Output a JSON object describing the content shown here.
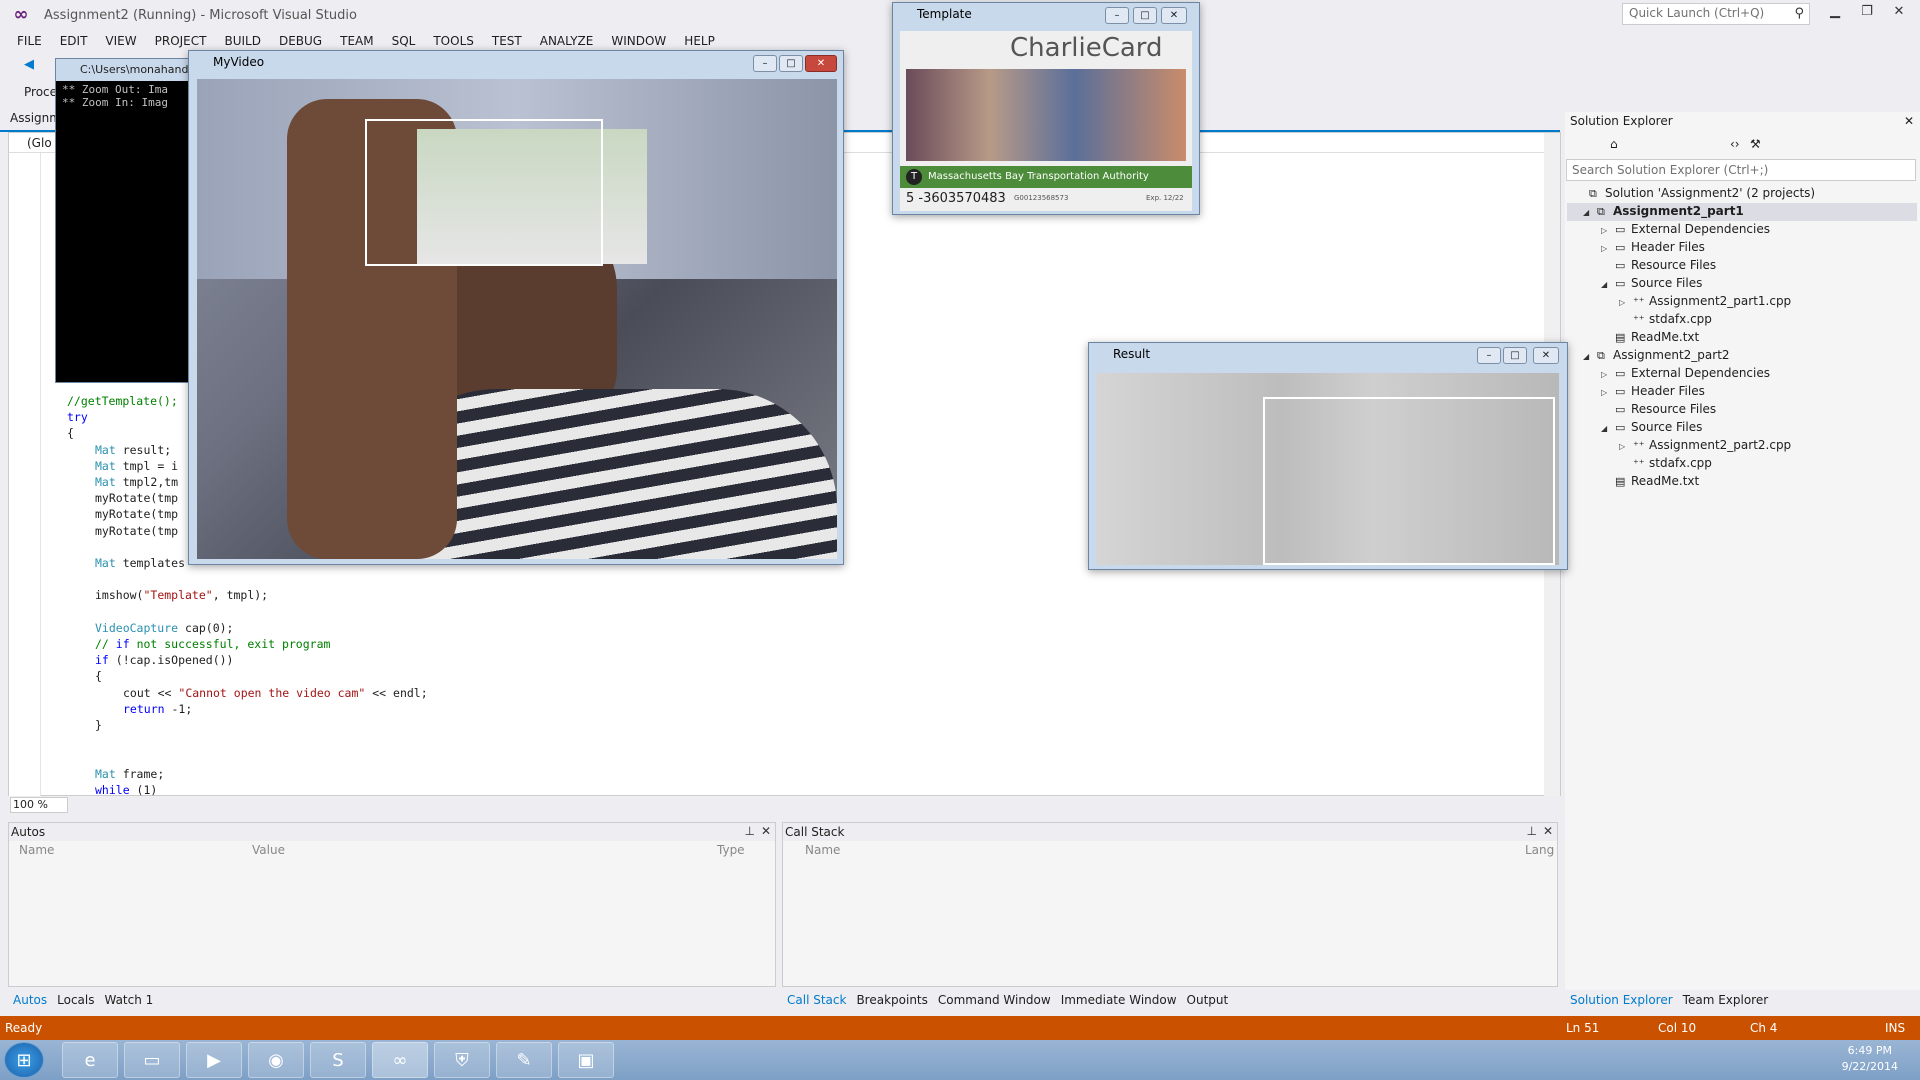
{
  "window": {
    "title": "Assignment2 (Running) - Microsoft Visual Studio",
    "quick_launch": "Quick Launch (Ctrl+Q)"
  },
  "menu": [
    "FILE",
    "EDIT",
    "VIEW",
    "PROJECT",
    "BUILD",
    "DEBUG",
    "TEAM",
    "SQL",
    "TOOLS",
    "TEST",
    "ANALYZE",
    "WINDOW",
    "HELP"
  ],
  "toolbar": {
    "process_label": "Proce",
    "doc_tab": "Assignm",
    "scope": "(Glo"
  },
  "code_lines": [
    {
      "cls": "cm",
      "indent": 1,
      "text": "//getTemplate();"
    },
    {
      "cls": "kw",
      "indent": 1,
      "text": "try"
    },
    {
      "cls": "",
      "indent": 1,
      "text": "{"
    },
    {
      "cls": "",
      "indent": 2,
      "text": "Mat result;"
    },
    {
      "cls": "",
      "indent": 2,
      "text": "Mat tmpl = i"
    },
    {
      "cls": "",
      "indent": 2,
      "text": "Mat tmpl2,tm"
    },
    {
      "cls": "",
      "indent": 2,
      "text": "myRotate(tmp"
    },
    {
      "cls": "",
      "indent": 2,
      "text": "myRotate(tmp"
    },
    {
      "cls": "",
      "indent": 2,
      "text": "myRotate(tmp"
    },
    {
      "cls": "",
      "indent": 0,
      "text": ""
    },
    {
      "cls": "",
      "indent": 2,
      "text": "Mat templates"
    },
    {
      "cls": "",
      "indent": 0,
      "text": ""
    },
    {
      "cls": "",
      "indent": 2,
      "text": "imshow(\"Template\", tmpl);"
    },
    {
      "cls": "",
      "indent": 0,
      "text": ""
    },
    {
      "cls": "",
      "indent": 2,
      "text": "VideoCapture cap(0);"
    },
    {
      "cls": "cm",
      "indent": 2,
      "text": "// if not successful, exit program"
    },
    {
      "cls": "",
      "indent": 2,
      "text": "if (!cap.isOpened())"
    },
    {
      "cls": "",
      "indent": 2,
      "text": "{"
    },
    {
      "cls": "",
      "indent": 3,
      "text": "cout << \"Cannot open the video cam\" << endl;"
    },
    {
      "cls": "",
      "indent": 3,
      "text": "return -1;"
    },
    {
      "cls": "",
      "indent": 2,
      "text": "}"
    },
    {
      "cls": "",
      "indent": 0,
      "text": ""
    },
    {
      "cls": "",
      "indent": 0,
      "text": ""
    },
    {
      "cls": "",
      "indent": 2,
      "text": "Mat frame;"
    },
    {
      "cls": "",
      "indent": 2,
      "text": "while (1)"
    }
  ],
  "editor": {
    "zoom": "100 %"
  },
  "autos": {
    "title": "Autos",
    "cols": [
      "Name",
      "Value",
      "Type"
    ]
  },
  "callstack": {
    "title": "Call Stack",
    "cols": [
      "Name",
      "Lang"
    ]
  },
  "bottom_tabs_left": [
    "Autos",
    "Locals",
    "Watch 1"
  ],
  "bottom_tabs_right": [
    "Call Stack",
    "Breakpoints",
    "Command Window",
    "Immediate Window",
    "Output"
  ],
  "solution_explorer": {
    "title": "Solution Explorer",
    "search": "Search Solution Explorer (Ctrl+;)",
    "nodes": [
      {
        "label": "Solution 'Assignment2' (2 projects)",
        "level": 0,
        "arrow": "",
        "bold": false
      },
      {
        "label": "Assignment2_part1",
        "level": 0,
        "arrow": "◢",
        "bold": true
      },
      {
        "label": "External Dependencies",
        "level": 1,
        "arrow": "▷",
        "bold": false
      },
      {
        "label": "Header Files",
        "level": 1,
        "arrow": "▷",
        "bold": false
      },
      {
        "label": "Resource Files",
        "level": 1,
        "arrow": "",
        "bold": false
      },
      {
        "label": "Source Files",
        "level": 1,
        "arrow": "◢",
        "bold": false
      },
      {
        "label": "Assignment2_part1.cpp",
        "level": 2,
        "arrow": "▷",
        "bold": false
      },
      {
        "label": "stdafx.cpp",
        "level": 2,
        "arrow": "",
        "bold": false
      },
      {
        "label": "ReadMe.txt",
        "level": 1,
        "arrow": "",
        "bold": false
      },
      {
        "label": "Assignment2_part2",
        "level": 0,
        "arrow": "◢",
        "bold": false
      },
      {
        "label": "External Dependencies",
        "level": 1,
        "arrow": "▷",
        "bold": false
      },
      {
        "label": "Header Files",
        "level": 1,
        "arrow": "▷",
        "bold": false
      },
      {
        "label": "Resource Files",
        "level": 1,
        "arrow": "",
        "bold": false
      },
      {
        "label": "Source Files",
        "level": 1,
        "arrow": "◢",
        "bold": false
      },
      {
        "label": "Assignment2_part2.cpp",
        "level": 2,
        "arrow": "▷",
        "bold": false
      },
      {
        "label": "stdafx.cpp",
        "level": 2,
        "arrow": "",
        "bold": false
      },
      {
        "label": "ReadMe.txt",
        "level": 1,
        "arrow": "",
        "bold": false
      }
    ],
    "tabs": [
      "Solution Explorer",
      "Team Explorer"
    ]
  },
  "status": {
    "ready": "Ready",
    "ln": "Ln 51",
    "col": "Col 10",
    "ch": "Ch 4",
    "mode": "INS"
  },
  "console": {
    "title": "C:\\Users\\monahand",
    "lines": [
      "** Zoom Out: Ima",
      "** Zoom In: Imag"
    ]
  },
  "myvideo": {
    "title": "MyVideo"
  },
  "template": {
    "title": "Template",
    "brand": "CharlieCard",
    "authority": "Massachusetts Bay Transportation Authority",
    "number": "5 -3603570483",
    "serial": "G00123568573",
    "exp": "Exp. 12/22"
  },
  "result": {
    "title": "Result"
  },
  "clock": {
    "time": "6:49 PM",
    "date": "9/22/2014"
  },
  "colors": {
    "accent": "#007acc",
    "statusbar": "#ca5100",
    "vs_purple": "#68217a"
  }
}
